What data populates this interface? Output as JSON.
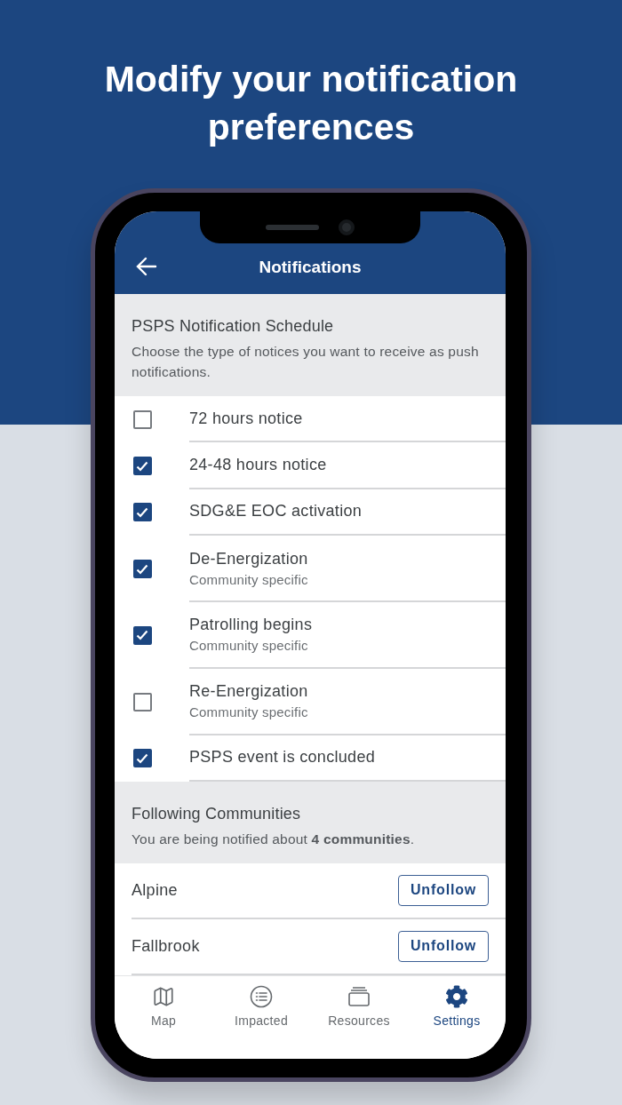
{
  "headline": "Modify your notification preferences",
  "header": {
    "title": "Notifications"
  },
  "schedule": {
    "title": "PSPS Notification Schedule",
    "description": "Choose the type of notices you want to receive as push notifications."
  },
  "options": [
    {
      "label": "72 hours notice",
      "checked": false
    },
    {
      "label": "24-48 hours notice",
      "checked": true
    },
    {
      "label": "SDG&E EOC activation",
      "checked": true
    },
    {
      "label": "De-Energization",
      "sublabel": "Community specific",
      "checked": true
    },
    {
      "label": "Patrolling begins",
      "sublabel": "Community specific",
      "checked": true
    },
    {
      "label": "Re-Energization",
      "sublabel": "Community specific",
      "checked": false
    },
    {
      "label": "PSPS event is concluded",
      "checked": true
    }
  ],
  "following": {
    "title": "Following Communities",
    "description": "You are being notified about **4 communities**."
  },
  "communities": [
    {
      "name": "Alpine",
      "action": "Unfollow"
    },
    {
      "name": "Fallbrook",
      "action": "Unfollow"
    }
  ],
  "tabs": [
    {
      "label": "Map",
      "selected": false
    },
    {
      "label": "Impacted",
      "selected": false
    },
    {
      "label": "Resources",
      "selected": false
    },
    {
      "label": "Settings",
      "selected": true
    }
  ]
}
